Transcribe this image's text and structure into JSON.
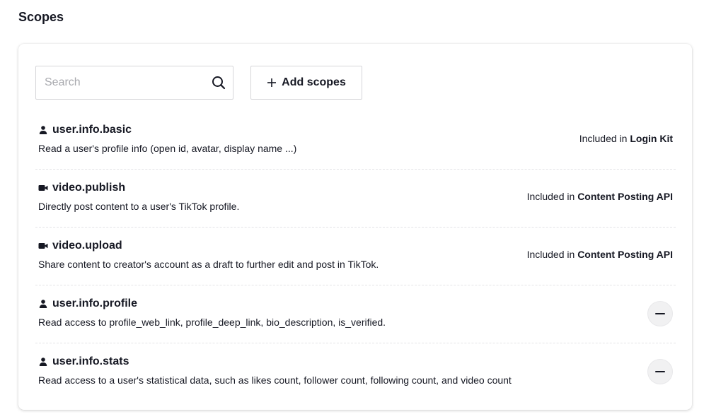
{
  "page": {
    "title": "Scopes"
  },
  "toolbar": {
    "search_placeholder": "Search",
    "add_label": "Add scopes"
  },
  "scopes": [
    {
      "icon": "user-icon",
      "name": "user.info.basic",
      "description": "Read a user's profile info (open id, avatar, display name ...)",
      "included_prefix": "Included in ",
      "included_product": "Login Kit"
    },
    {
      "icon": "video-camera-icon",
      "name": "video.publish",
      "description": "Directly post content to a user's TikTok profile.",
      "included_prefix": "Included in ",
      "included_product": "Content Posting API"
    },
    {
      "icon": "video-camera-icon",
      "name": "video.upload",
      "description": "Share content to creator's account as a draft to further edit and post in TikTok.",
      "included_prefix": "Included in ",
      "included_product": "Content Posting API"
    },
    {
      "icon": "user-icon",
      "name": "user.info.profile",
      "description": "Read access to profile_web_link, profile_deep_link, bio_description, is_verified."
    },
    {
      "icon": "user-icon",
      "name": "user.info.stats",
      "description": "Read access to a user's statistical data, such as likes count, follower count, following count, and video count"
    }
  ]
}
